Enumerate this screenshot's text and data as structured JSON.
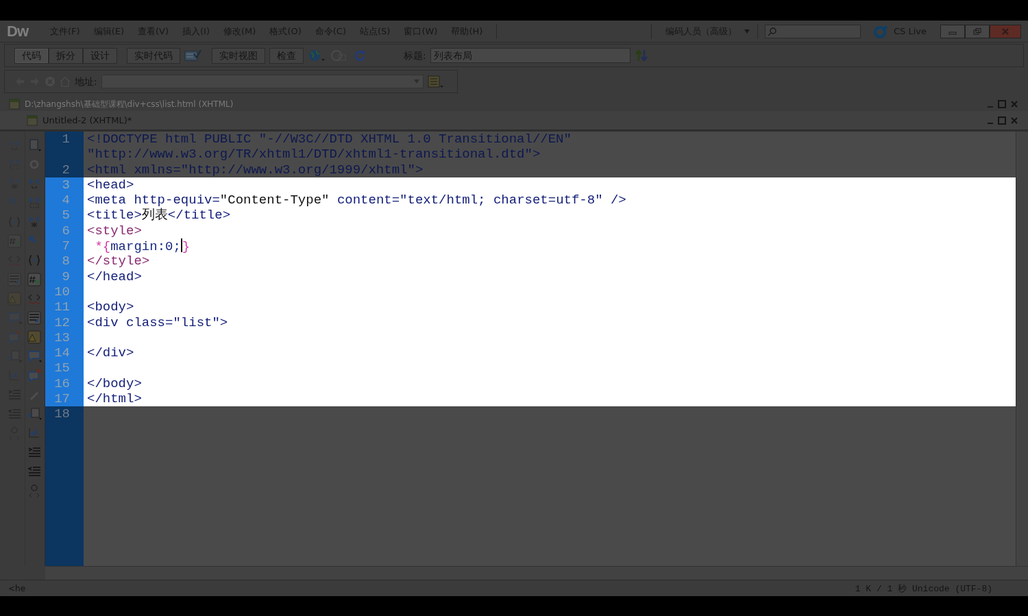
{
  "app": {
    "logo": "Dw",
    "workspace": "编码人员（高级）",
    "cs_live": "CS Live"
  },
  "menu": [
    {
      "label": "文件(F)"
    },
    {
      "label": "编辑(E)"
    },
    {
      "label": "查看(V)"
    },
    {
      "label": "插入(I)"
    },
    {
      "label": "修改(M)"
    },
    {
      "label": "格式(O)"
    },
    {
      "label": "命令(C)"
    },
    {
      "label": "站点(S)"
    },
    {
      "label": "窗口(W)"
    },
    {
      "label": "帮助(H)"
    }
  ],
  "view_buttons": [
    {
      "label": "代码",
      "selected": true
    },
    {
      "label": "拆分",
      "selected": false
    },
    {
      "label": "设计",
      "selected": false
    }
  ],
  "live_code": "实时代码",
  "live_view": "实时视图",
  "inspect": "检查",
  "title_field": {
    "label": "标题:",
    "value": "列表布局"
  },
  "address_field": {
    "label": "地址:"
  },
  "documents": [
    {
      "title": "D:\\zhangshsh\\基础型课程\\div+css\\list.html (XHTML)",
      "active": false
    },
    {
      "title": "Untitled-2 (XHTML)*",
      "active": true
    }
  ],
  "code": {
    "lines": [
      {
        "number": "1",
        "highlighted": false,
        "rows": [
          [
            {
              "text": "<!DOCTYPE html PUBLIC \"-//W3C//DTD XHTML 1.0 Transitional//EN\"",
              "kind": "tag"
            }
          ],
          [
            {
              "text": "\"http://www.w3.org/TR/xhtml1/DTD/xhtml1-transitional.dtd\">",
              "kind": "tag"
            }
          ]
        ]
      },
      {
        "number": "2",
        "highlighted": false,
        "rows": [
          [
            {
              "text": "<html xmlns=\"http://www.w3.org/1999/xhtml\">",
              "kind": "tag"
            }
          ]
        ]
      },
      {
        "number": "3",
        "highlighted": true,
        "rows": [
          [
            {
              "text": "<head>",
              "kind": "tag"
            }
          ]
        ]
      },
      {
        "number": "4",
        "highlighted": true,
        "rows": [
          [
            {
              "text": "<meta http-equiv=",
              "kind": "tag"
            },
            {
              "text": "\"Content-Type\"",
              "kind": "text"
            },
            {
              "text": " content=\"text/html; charset=utf-8\" />",
              "kind": "tag"
            }
          ]
        ]
      },
      {
        "number": "5",
        "highlighted": true,
        "rows": [
          [
            {
              "text": "<title>",
              "kind": "tag"
            },
            {
              "text": "列表",
              "kind": "text"
            },
            {
              "text": "</title>",
              "kind": "tag"
            }
          ]
        ]
      },
      {
        "number": "6",
        "highlighted": true,
        "rows": [
          [
            {
              "text": "<style>",
              "kind": "style"
            }
          ]
        ]
      },
      {
        "number": "7",
        "highlighted": true,
        "rows": [
          [
            {
              "text": " *{",
              "kind": "punct"
            },
            {
              "text": "margin:0;",
              "kind": "prop"
            },
            {
              "kind": "caret"
            },
            {
              "text": "}",
              "kind": "punct"
            }
          ]
        ]
      },
      {
        "number": "8",
        "highlighted": true,
        "rows": [
          [
            {
              "text": "</style>",
              "kind": "style"
            }
          ]
        ]
      },
      {
        "number": "9",
        "highlighted": true,
        "rows": [
          [
            {
              "text": "</head>",
              "kind": "tag"
            }
          ]
        ]
      },
      {
        "number": "10",
        "highlighted": true,
        "rows": [
          []
        ]
      },
      {
        "number": "11",
        "highlighted": true,
        "rows": [
          [
            {
              "text": "<body>",
              "kind": "tag"
            }
          ]
        ]
      },
      {
        "number": "12",
        "highlighted": true,
        "rows": [
          [
            {
              "text": "<div class=\"list\">",
              "kind": "tag"
            }
          ]
        ]
      },
      {
        "number": "13",
        "highlighted": true,
        "rows": [
          []
        ]
      },
      {
        "number": "14",
        "highlighted": true,
        "rows": [
          [
            {
              "text": "</div>",
              "kind": "tag"
            }
          ]
        ]
      },
      {
        "number": "15",
        "highlighted": true,
        "rows": [
          []
        ]
      },
      {
        "number": "16",
        "highlighted": true,
        "rows": [
          [
            {
              "text": "</body>",
              "kind": "tag"
            }
          ]
        ]
      },
      {
        "number": "17",
        "highlighted": true,
        "rows": [
          [
            {
              "text": "</html>",
              "kind": "tag"
            }
          ]
        ]
      },
      {
        "number": "18",
        "highlighted": false,
        "rows": [
          []
        ]
      }
    ]
  },
  "status": {
    "tag": "<he",
    "info": "1 K / 1 秒 Unicode (UTF-8)"
  }
}
